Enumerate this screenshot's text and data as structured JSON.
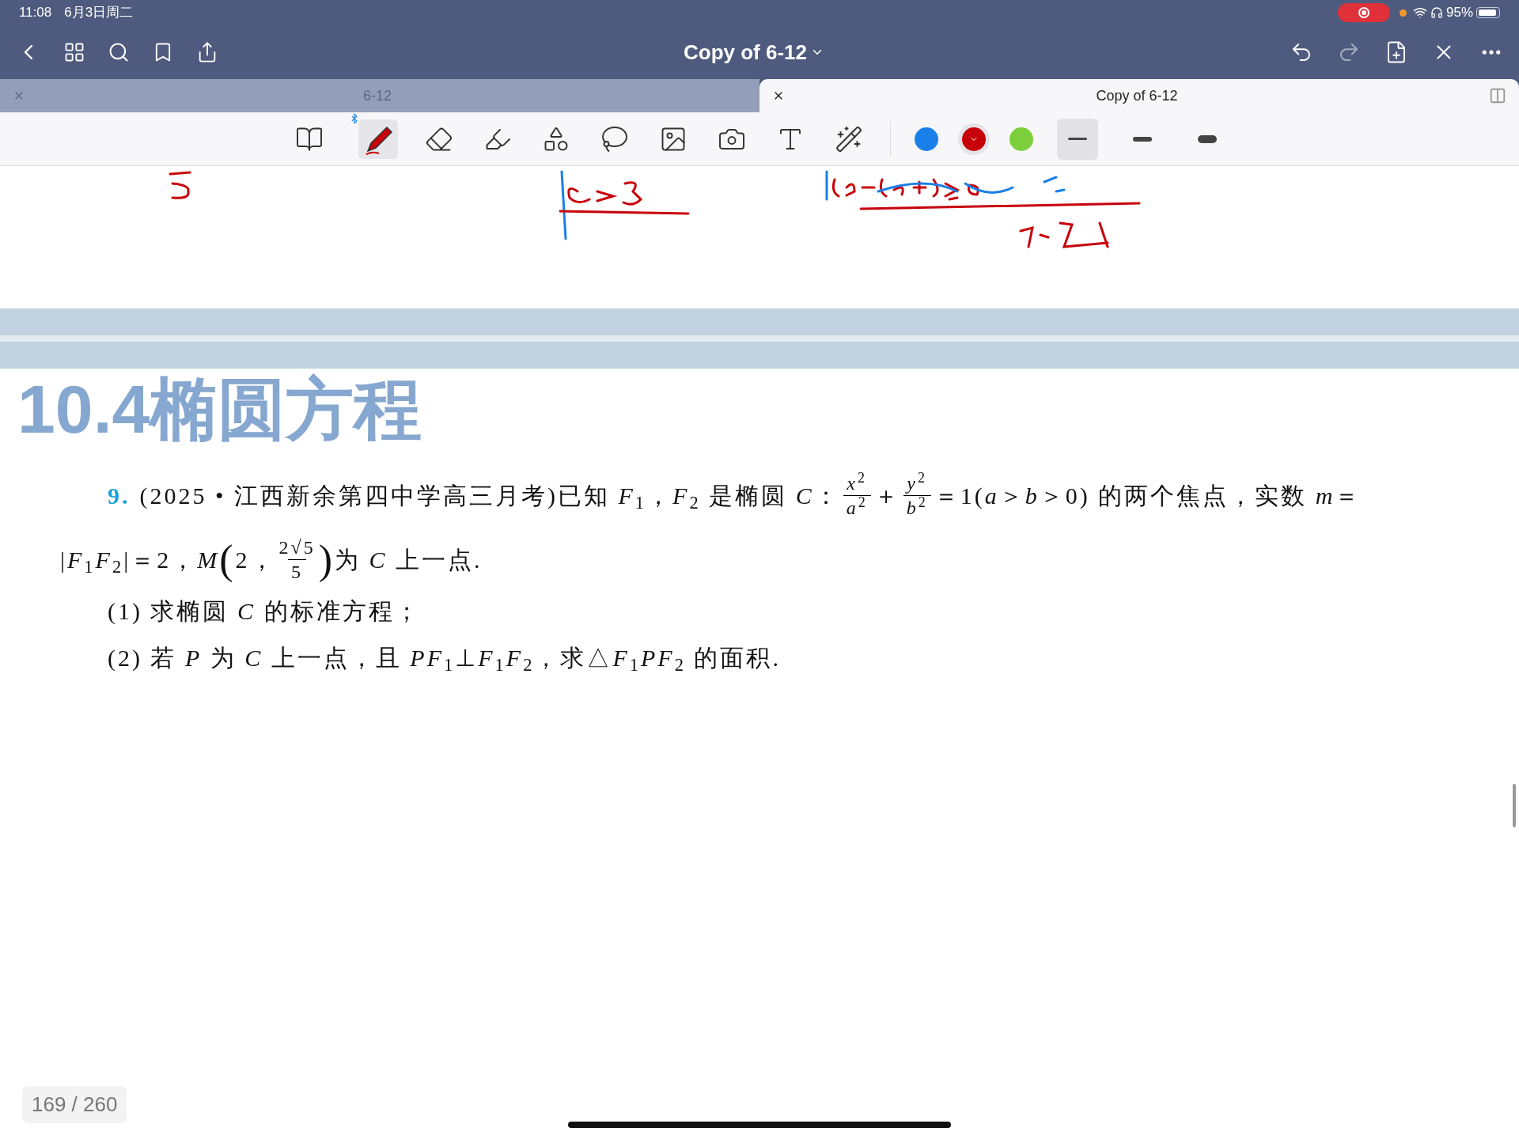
{
  "status_bar": {
    "time": "11:08",
    "date": "6月3日周二",
    "recording": true,
    "battery": "95%"
  },
  "nav": {
    "title": "Copy of 6-12"
  },
  "tabs": [
    {
      "label": "6-12",
      "selected": false
    },
    {
      "label": "Copy of 6-12",
      "selected": true
    }
  ],
  "toolbar": {
    "tools": [
      {
        "kind": "reader",
        "selected": false
      },
      {
        "kind": "pen",
        "selected": true
      },
      {
        "kind": "eraser",
        "selected": false
      },
      {
        "kind": "highlighter",
        "selected": false
      },
      {
        "kind": "shapes",
        "selected": false
      },
      {
        "kind": "lasso",
        "selected": false
      },
      {
        "kind": "image",
        "selected": false
      },
      {
        "kind": "camera",
        "selected": false
      },
      {
        "kind": "textbox",
        "selected": false
      },
      {
        "kind": "laser",
        "selected": false
      }
    ],
    "colors": [
      {
        "color": "#1a7fe8",
        "selected": false
      },
      {
        "color": "#c8000a",
        "selected": true
      },
      {
        "color": "#7ccf3a",
        "selected": false
      }
    ],
    "widths": [
      {
        "kind": "thin",
        "selected": true
      },
      {
        "kind": "medium",
        "selected": false
      },
      {
        "kind": "thick",
        "selected": false
      }
    ]
  },
  "page": {
    "heading": "10.4椭圆方程",
    "number": "9.",
    "line1": [
      {
        "kind": "text",
        "text": "(2025 • 江西新余第四中学高三月考)已知 *F*$_{1}$，*F*$_{2}$ 是椭圆 *C*："
      },
      {
        "kind": "fraction",
        "num": "*x*$^{2}$",
        "den": "*a*$^{2}$"
      },
      {
        "kind": "text",
        "text": "＋"
      },
      {
        "kind": "fraction",
        "num": "*y*$^{2}$",
        "den": "*b*$^{2}$"
      },
      {
        "kind": "text",
        "text": "＝1(*a*＞*b*＞0) 的两个焦点，实数 *m*＝"
      }
    ],
    "line2": [
      {
        "kind": "text",
        "text": "|*F*$_{1}$*F*$_{2}$|＝2，*M*"
      },
      {
        "kind": "bracket",
        "text": "("
      },
      {
        "kind": "text",
        "text": "2，"
      },
      {
        "kind": "fraction",
        "num": "2√5",
        "den": "5"
      },
      {
        "kind": "bracket",
        "text": ")"
      },
      {
        "kind": "text",
        "text": "为 *C* 上一点."
      }
    ],
    "parts": [
      "(1) 求椭圆 *C* 的标准方程；",
      "(2) 若 *P* 为 *C* 上一点，且 *PF*$_{1}$⊥*F*$_{1}$*F*$_{2}$，求△*F*$_{1}$*PF*$_{2}$ 的面积."
    ]
  },
  "page_counter": "169 / 260"
}
